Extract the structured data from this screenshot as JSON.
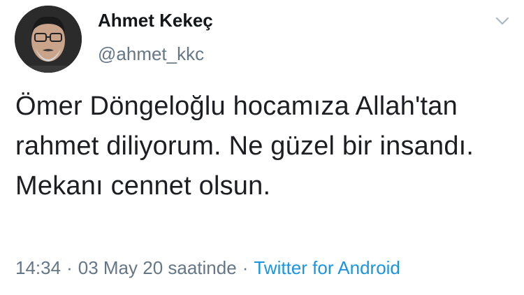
{
  "author": {
    "name": "Ahmet Kekeç",
    "handle": "@ahmet_kkc",
    "avatar_icon": "profile-photo"
  },
  "menu": {
    "icon": "chevron-down-icon"
  },
  "tweet": {
    "text": "Ömer Döngeloğlu hocamıza Allah'tan rahmet diliyorum. Ne güzel bir insandı. Mekanı cennet olsun."
  },
  "meta": {
    "time": "14:34",
    "separator": "·",
    "date": "03 May 20 saatinde",
    "source": "Twitter for Android"
  },
  "colors": {
    "text": "#14171a",
    "muted": "#657786",
    "link": "#1b95e0",
    "background": "#ffffff"
  }
}
